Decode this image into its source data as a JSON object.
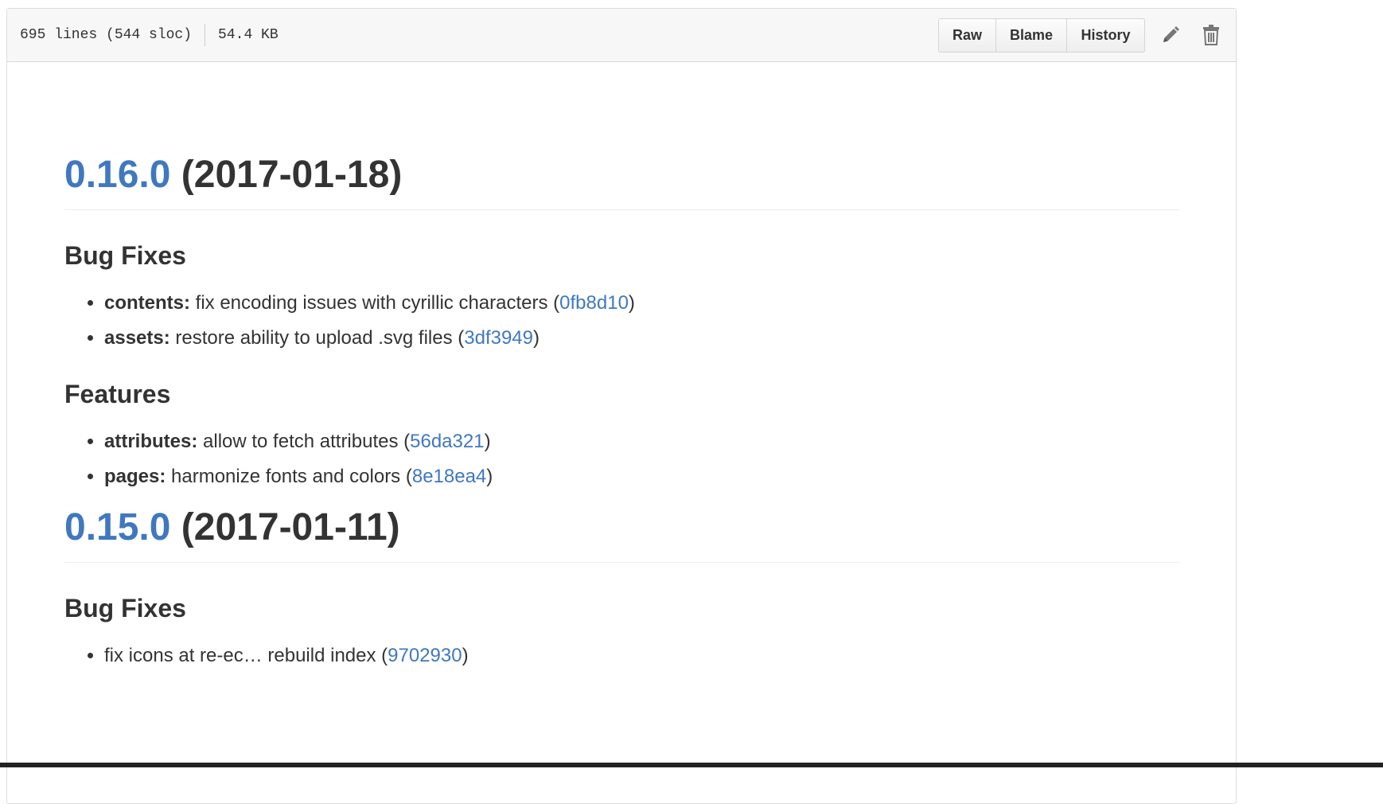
{
  "file_header": {
    "lines": "695 lines (544 sloc)",
    "size": "54.4 KB",
    "buttons": {
      "raw": "Raw",
      "blame": "Blame",
      "history": "History"
    },
    "icons": [
      "pencil-icon",
      "trash-icon"
    ]
  },
  "releases": [
    {
      "version": "0.16.0",
      "date": "(2017-01-18)",
      "sections": [
        {
          "title": "Bug Fixes",
          "items": [
            {
              "scope": "contents:",
              "text": " fix encoding issues with cyrillic characters (",
              "hash": "0fb8d10",
              "close": ")"
            },
            {
              "scope": "assets:",
              "text": " restore ability to upload .svg files (",
              "hash": "3df3949",
              "close": ")"
            }
          ]
        },
        {
          "title": "Features",
          "items": [
            {
              "scope": "attributes:",
              "text": " allow to fetch attributes (",
              "hash": "56da321",
              "close": ")"
            },
            {
              "scope": "pages:",
              "text": " harmonize fonts and colors (",
              "hash": "8e18ea4",
              "close": ")"
            }
          ]
        }
      ]
    },
    {
      "version": "0.15.0",
      "date": "(2017-01-11)",
      "sections": [
        {
          "title": "Bug Fixes",
          "items": [
            {
              "scope": "",
              "text": "fix icons at re-ec… rebuild index (",
              "hash": "9702930",
              "close": ")"
            }
          ]
        }
      ]
    }
  ],
  "colors": {
    "link": "#4078c0",
    "text": "#333333",
    "header_bg": "#f7f7f7"
  }
}
